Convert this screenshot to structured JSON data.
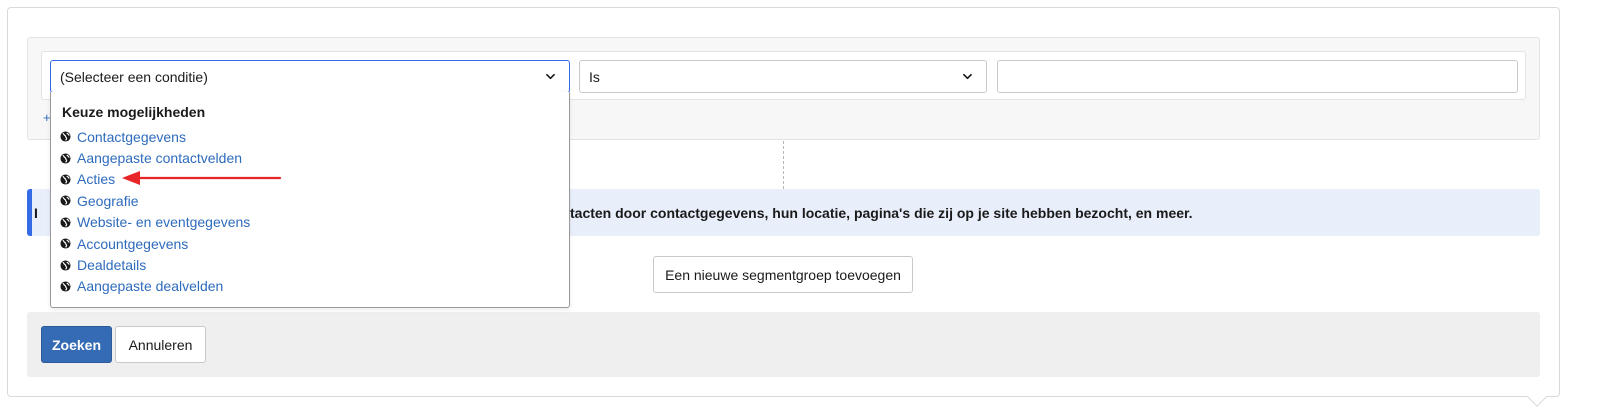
{
  "condition": {
    "field_select_value": "(Selecteer een conditie)",
    "operator_select_value": "Is",
    "value_input": "",
    "add_condition_label": "+"
  },
  "dropdown": {
    "heading": "Keuze mogelijkheden",
    "items": [
      "Contactgegevens",
      "Aangepaste contactvelden",
      "Acties",
      "Geografie",
      "Website- en eventgegevens",
      "Accountgegevens",
      "Dealdetails",
      "Aangepaste dealvelden"
    ]
  },
  "info_banner": {
    "lead": "I",
    "text": "tacten door contactgegevens, hun locatie, pagina's die zij op je site hebben bezocht, en meer."
  },
  "new_segment_group_label": "Een nieuwe segmentgroep toevoegen",
  "footer": {
    "search_label": "Zoeken",
    "cancel_label": "Annuleren"
  },
  "colors": {
    "accent": "#356ae6",
    "link": "#2e6bbd",
    "primary_button": "#356ab5",
    "banner_bg": "#e9eefb",
    "annotation_arrow": "#e8262a"
  },
  "icons": {
    "dropdown_item_icon": "globe-icon",
    "select_icon": "chevron-down-icon"
  }
}
